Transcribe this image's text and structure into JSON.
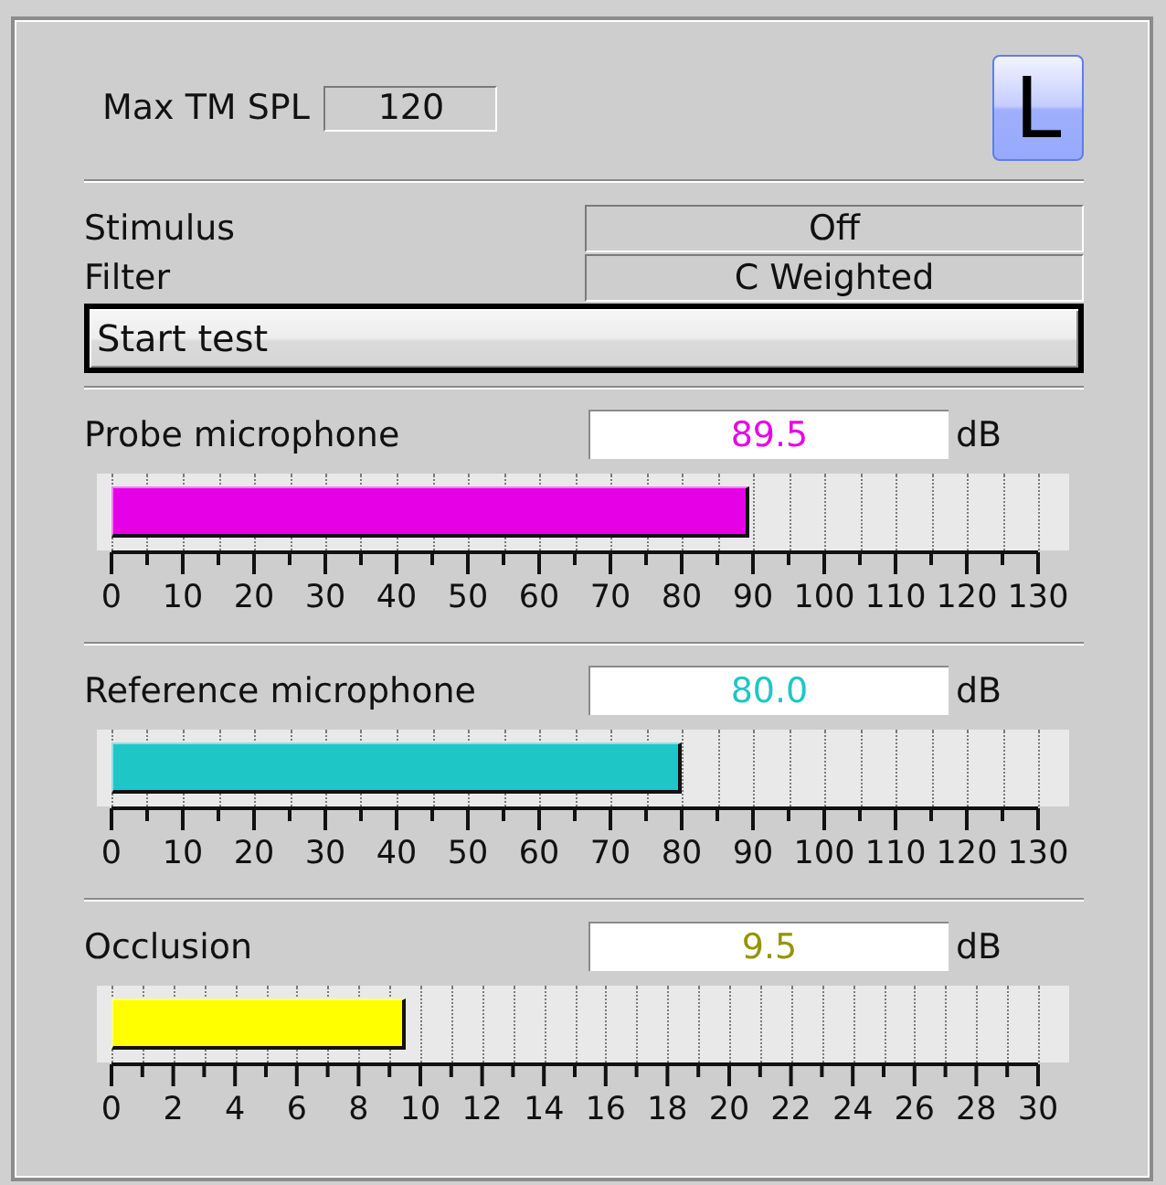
{
  "max_tm_spl": {
    "label": "Max TM SPL",
    "value": "120"
  },
  "side_button": "L",
  "status": [
    {
      "label": "Stimulus",
      "value": "Off"
    },
    {
      "label": "Filter",
      "value": "C Weighted"
    }
  ],
  "start_button": "Start test",
  "meters": [
    {
      "label": "Probe microphone",
      "reading": "89.5",
      "unit": "dB",
      "color": "#e600e6",
      "level": 0.6885,
      "scale": [
        "0",
        "10",
        "20",
        "30",
        "40",
        "50",
        "60",
        "70",
        "80",
        "90",
        "100",
        "110",
        "120",
        "130"
      ]
    },
    {
      "label": "Reference microphone",
      "reading": "80.0",
      "unit": "dB",
      "color": "#1fc6c6",
      "level": 0.6154,
      "scale": [
        "0",
        "10",
        "20",
        "30",
        "40",
        "50",
        "60",
        "70",
        "80",
        "90",
        "100",
        "110",
        "120",
        "130"
      ]
    },
    {
      "label": "Occlusion",
      "reading": "9.5",
      "unit": "dB",
      "color": "#ffff00",
      "level": 0.3167,
      "scale": [
        "0",
        "2",
        "4",
        "6",
        "8",
        "10",
        "12",
        "14",
        "16",
        "18",
        "20",
        "22",
        "24",
        "26",
        "28",
        "30"
      ]
    }
  ]
}
